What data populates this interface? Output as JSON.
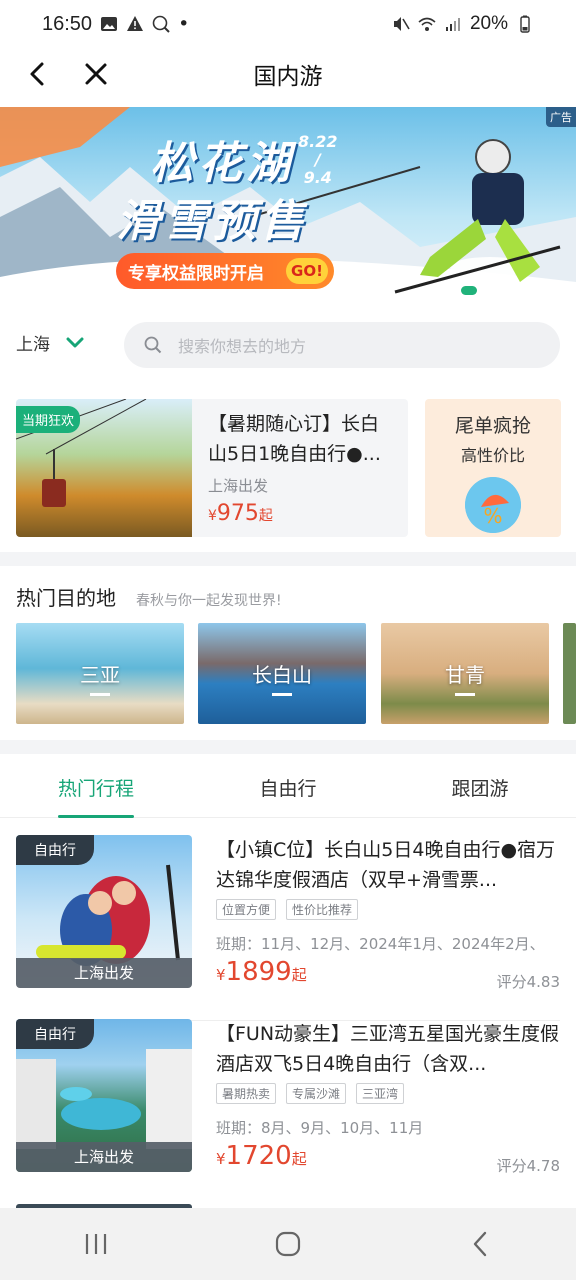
{
  "status": {
    "time": "16:50",
    "battery": "20%"
  },
  "appbar": {
    "title": "国内游"
  },
  "banner": {
    "title_line1": "松花湖",
    "title_line2": "滑雪预售",
    "dates_top": "8.22",
    "dates_sep": "/",
    "dates_bottom": "9.4",
    "promo": "专享权益限时开启",
    "go": "GO!",
    "ad_tag": "广告"
  },
  "location": {
    "city": "上海"
  },
  "search": {
    "placeholder": "搜索你想去的地方"
  },
  "deal": {
    "badge": "当期狂欢",
    "name": "【暑期随心订】长白山5日1晚自由行●...",
    "depart": "上海出发",
    "currency": "¥",
    "price": "975",
    "suffix": "起"
  },
  "tail_sale": {
    "title": "尾单疯抢",
    "subtitle": "高性价比"
  },
  "destinations": {
    "heading": "热门目的地",
    "subheading": "春秋与你一起发现世界!",
    "items": [
      {
        "label": "三亚"
      },
      {
        "label": "长白山"
      },
      {
        "label": "甘青"
      }
    ]
  },
  "tabs": [
    {
      "label": "热门行程",
      "active": true
    },
    {
      "label": "自由行",
      "active": false
    },
    {
      "label": "跟团游",
      "active": false
    }
  ],
  "trips": [
    {
      "kind": "自由行",
      "depart": "上海出发",
      "name": "【小镇C位】长白山5日4晚自由行●宿万达锦华度假酒店（双早+滑雪票...",
      "tags": [
        "位置方便",
        "性价比推荐"
      ],
      "schedule": "班期：11月、12月、2024年1月、2024年2月、",
      "currency": "¥",
      "price": "1899",
      "suffix": "起",
      "score": "评分4.83"
    },
    {
      "kind": "自由行",
      "depart": "上海出发",
      "name": "【FUN动豪生】三亚湾五星国光豪生度假酒店双飞5日4晚自由行（含双...",
      "tags": [
        "暑期热卖",
        "专属沙滩",
        "三亚湾"
      ],
      "schedule": "班期：8月、9月、10月、11月",
      "currency": "¥",
      "price": "1720",
      "suffix": "起",
      "score": "评分4.78"
    }
  ],
  "colors": {
    "accent": "#17a577",
    "price": "#e2472f"
  }
}
